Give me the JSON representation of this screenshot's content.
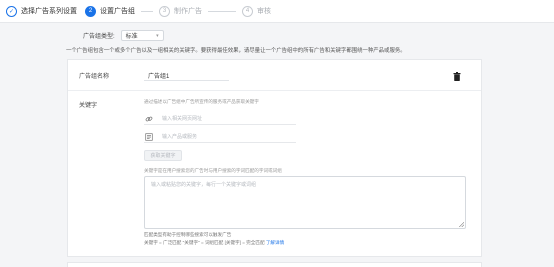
{
  "steps": [
    {
      "num": "✓",
      "label": "选择广告系列设置"
    },
    {
      "num": "2",
      "label": "设置广告组"
    },
    {
      "num": "3",
      "label": "制作广告"
    },
    {
      "num": "4",
      "label": "审核"
    }
  ],
  "type_row": {
    "label": "广告组类型:",
    "value": "标准"
  },
  "description": "一个广告组包含一个或多个广告以及一组相关的关键字。要获得最佳效果，请尽量让一个广告组中的所有广告和关键字都围绕一种产品或服务。",
  "card": {
    "name_label": "广告组名称",
    "name_value": "广告组1",
    "keywords_label": "关键字",
    "kw_hint": "通过描述以广告组中广告所宣传的服务或产品获取关键字",
    "url_placeholder": "输入相关网页网址",
    "product_placeholder": "输入产品或服务",
    "fetch_button": "获取关键字",
    "kw_hint2": "关键字是在用户搜索您的广告时与用户搜索的字词匹配的字词或词组",
    "textarea_placeholder": "输入或粘贴您的关键字，每行一个关键字或词组",
    "footer_line1": "匹配类型有助于控制哪些搜索可以触发广告",
    "footer_line2_prefix": "关键字 = 广泛匹配 \"关键字\" = 词组匹配 [关键字] = 完全匹配",
    "footer_link": "了解详情"
  },
  "colors": {
    "accent": "#1a73e8"
  },
  "icons": [
    "check-icon",
    "chevron-down-icon",
    "trash-icon",
    "link-icon",
    "product-icon"
  ]
}
